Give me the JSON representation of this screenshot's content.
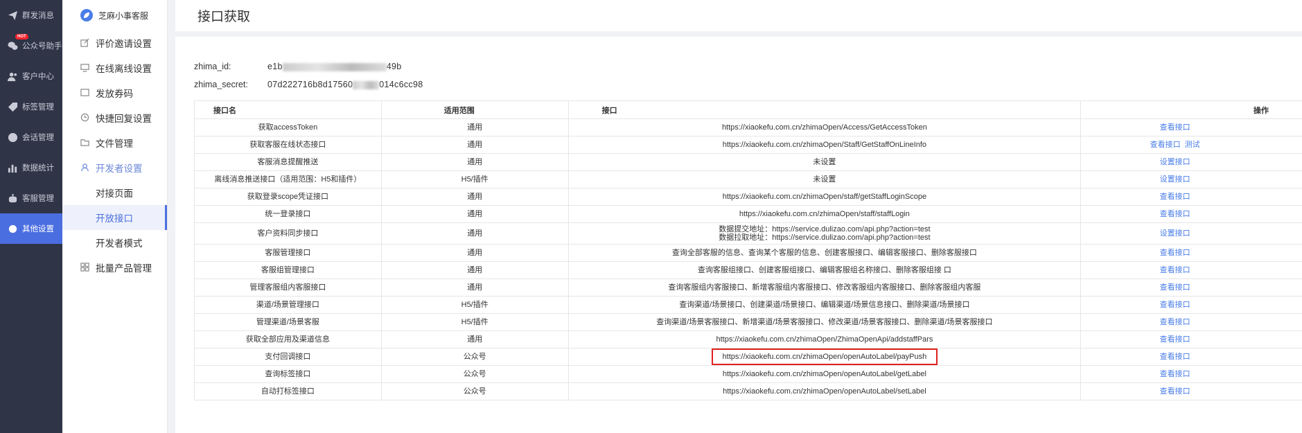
{
  "nav": {
    "items": [
      {
        "label": "群发消息",
        "icon": "send-icon"
      },
      {
        "label": "公众号助手",
        "icon": "wechat-icon",
        "badge": "HOT"
      },
      {
        "label": "客户中心",
        "icon": "users-icon"
      },
      {
        "label": "标签管理",
        "icon": "tag-icon"
      },
      {
        "label": "会话管理",
        "icon": "chat-icon"
      },
      {
        "label": "数据统计",
        "icon": "bar-chart-icon"
      },
      {
        "label": "客服管理",
        "icon": "robot-icon"
      },
      {
        "label": "其他设置",
        "icon": "gear-icon"
      }
    ]
  },
  "subnav": {
    "brand": "芝麻小事客服",
    "items": [
      {
        "label": "评价邀请设置",
        "icon": "edit-icon"
      },
      {
        "label": "在线离线设置",
        "icon": "monitor-icon"
      },
      {
        "label": "发放券码",
        "icon": "image-icon"
      },
      {
        "label": "快捷回复设置",
        "icon": "reply-icon"
      },
      {
        "label": "文件管理",
        "icon": "folder-icon"
      },
      {
        "label": "开发者设置",
        "icon": "developer-icon"
      },
      {
        "label": "批量产品管理",
        "icon": "grid-icon"
      }
    ],
    "children": [
      "对接页面",
      "开放接口",
      "开发者模式"
    ]
  },
  "page": {
    "title": "接口获取"
  },
  "creds": {
    "id_label": "zhima_id:",
    "id_prefix": "e1b",
    "id_suffix": "49b",
    "secret_label": "zhima_secret:",
    "secret_prefix": "07d222716b8d17560",
    "secret_suffix": "014c6cc98"
  },
  "table": {
    "headers": {
      "name": "接口名",
      "scope": "适用范围",
      "api": "接口",
      "op": "操作"
    },
    "rows": [
      {
        "name": "获取accessToken",
        "scope": "通用",
        "api": "https://xiaokefu.com.cn/zhimaOpen/Access/GetAccessToken",
        "ops": [
          "查看接口"
        ]
      },
      {
        "name": "获取客服在线状态接口",
        "scope": "通用",
        "api": "https://xiaokefu.com.cn/zhimaOpen/Staff/GetStaffOnLineInfo",
        "ops": [
          "查看接口",
          "测试"
        ]
      },
      {
        "name": "客服消息提醒推送",
        "scope": "通用",
        "api": "未设置",
        "ops": [
          "设置接口"
        ]
      },
      {
        "name": "离线消息推送接口（适用范围：H5和插件）",
        "scope": "H5/插件",
        "api": "未设置",
        "ops": [
          "设置接口"
        ]
      },
      {
        "name": "获取登录scope凭证接口",
        "scope": "通用",
        "api": "https://xiaokefu.com.cn/zhimaOpen/staff/getStaffLoginScope",
        "ops": [
          "查看接口"
        ]
      },
      {
        "name": "统一登录接口",
        "scope": "通用",
        "api": "https://xiaokefu.com.cn/zhimaOpen/staff/staffLogin",
        "ops": [
          "查看接口"
        ]
      },
      {
        "name": "客户资料同步接口",
        "scope": "通用",
        "api": "数据提交地址：https://service.dulizao.com/api.php?action=test",
        "api2": "数据拉取地址：https://service.dulizao.com/api.php?action=test",
        "ops": [
          "设置接口"
        ]
      },
      {
        "name": "客服管理接口",
        "scope": "通用",
        "api": "查询全部客服的信息、查询某个客服的信息、创建客服接口、编辑客服接口、删除客服接口",
        "ops": [
          "查看接口"
        ]
      },
      {
        "name": "客服组管理接口",
        "scope": "通用",
        "api": "查询客服组接口、创建客服组接口、编辑客服组名称接口、删除客服组接 口",
        "ops": [
          "查看接口"
        ]
      },
      {
        "name": "管理客服组内客服接口",
        "scope": "通用",
        "api": "查询客服组内客服接口、新增客服组内客服接口、修改客服组内客服接口、删除客服组内客服",
        "ops": [
          "查看接口"
        ]
      },
      {
        "name": "渠道/场景管理接口",
        "scope": "H5/插件",
        "api": "查询渠道/场景接口、创建渠道/场景接口、编辑渠道/场景信息接口、删除渠道/场景接口",
        "ops": [
          "查看接口"
        ]
      },
      {
        "name": "管理渠道/场景客服",
        "scope": "H5/插件",
        "api": "查询渠道/场景客服接口、新增渠道/场景客服接口、修改渠道/场景客服接口、删除渠道/场景客服接口",
        "ops": [
          "查看接口"
        ]
      },
      {
        "name": "获取全部应用及渠道信息",
        "scope": "通用",
        "api": "https://xiaokefu.com.cn/zhimaOpen/ZhimaOpenApi/addstaffPars",
        "ops": [
          "查看接口"
        ]
      },
      {
        "name": "支付回调接口",
        "scope": "公众号",
        "api": "https://xiaokefu.com.cn/zhimaOpen/openAutoLabel/payPush",
        "ops": [
          "查看接口"
        ],
        "highlight": true
      },
      {
        "name": "查询标签接口",
        "scope": "公众号",
        "api": "https://xiaokefu.com.cn/zhimaOpen/openAutoLabel/getLabel",
        "ops": [
          "查看接口"
        ]
      },
      {
        "name": "自动打标签接口",
        "scope": "公众号",
        "api": "https://xiaokefu.com.cn/zhimaOpen/openAutoLabel/setLabel",
        "ops": [
          "查看接口"
        ]
      }
    ]
  }
}
